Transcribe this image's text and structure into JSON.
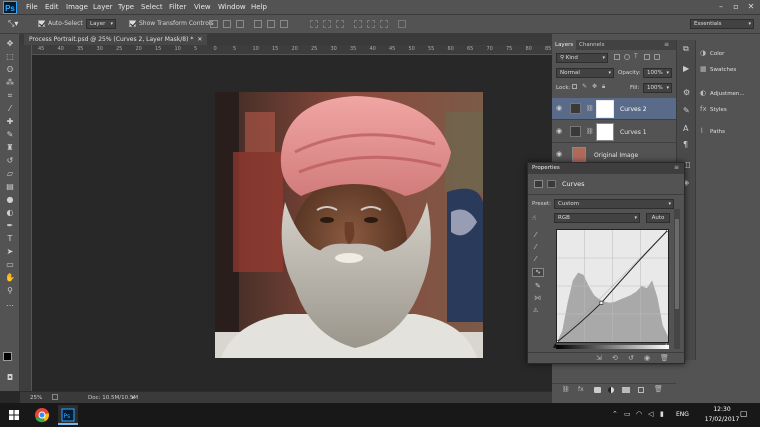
{
  "app": {
    "logo": "Ps"
  },
  "menu": [
    "File",
    "Edit",
    "Image",
    "Layer",
    "Type",
    "Select",
    "Filter",
    "View",
    "Window",
    "Help"
  ],
  "options_bar": {
    "auto_select": "Auto-Select",
    "auto_select_target": "Layer",
    "transform_controls": "Show Transform Controls",
    "workspace": "Essentials"
  },
  "document_tab": "Process Portrait.psd @ 25% (Curves 2, Layer Mask/8) *",
  "ruler_h": [
    "45",
    "40",
    "35",
    "30",
    "25",
    "20",
    "15",
    "10",
    "5",
    "0",
    "5",
    "10",
    "15",
    "20",
    "25",
    "30",
    "35",
    "40",
    "45",
    "50",
    "55",
    "60",
    "65",
    "70",
    "75",
    "80",
    "85"
  ],
  "status": {
    "zoom": "25%",
    "doc": "Doc: 10.5M/10.5M"
  },
  "layers_panel": {
    "tabs": [
      "Layers",
      "Channels"
    ],
    "filter": "Kind",
    "blend_mode": "Normal",
    "opacity_label": "Opacity:",
    "opacity": "100%",
    "lock_label": "Lock:",
    "fill_label": "Fill:",
    "fill": "100%",
    "layers": [
      {
        "name": "Curves 2",
        "selected": true
      },
      {
        "name": "Curves 1",
        "selected": false
      },
      {
        "name": "Original Image",
        "selected": false
      }
    ]
  },
  "right_panels": [
    "Color",
    "Swatches",
    "Adjustmen...",
    "Styles",
    "Paths"
  ],
  "properties": {
    "title": "Properties",
    "adjustment": "Curves",
    "preset_label": "Preset:",
    "preset": "Custom",
    "channel": "RGB",
    "auto_button": "Auto"
  },
  "curve": {
    "points": [
      [
        0,
        0
      ],
      [
        40,
        35
      ],
      [
        100,
        100
      ]
    ]
  },
  "taskbar": {
    "language": "ENG",
    "time": "12:30",
    "date": "17/02/2017"
  },
  "colors": {
    "ui_dark": "#535353",
    "canvas_bg": "#282828",
    "selected_layer": "#5a6b8a",
    "ps_blue": "#31a8ff"
  }
}
